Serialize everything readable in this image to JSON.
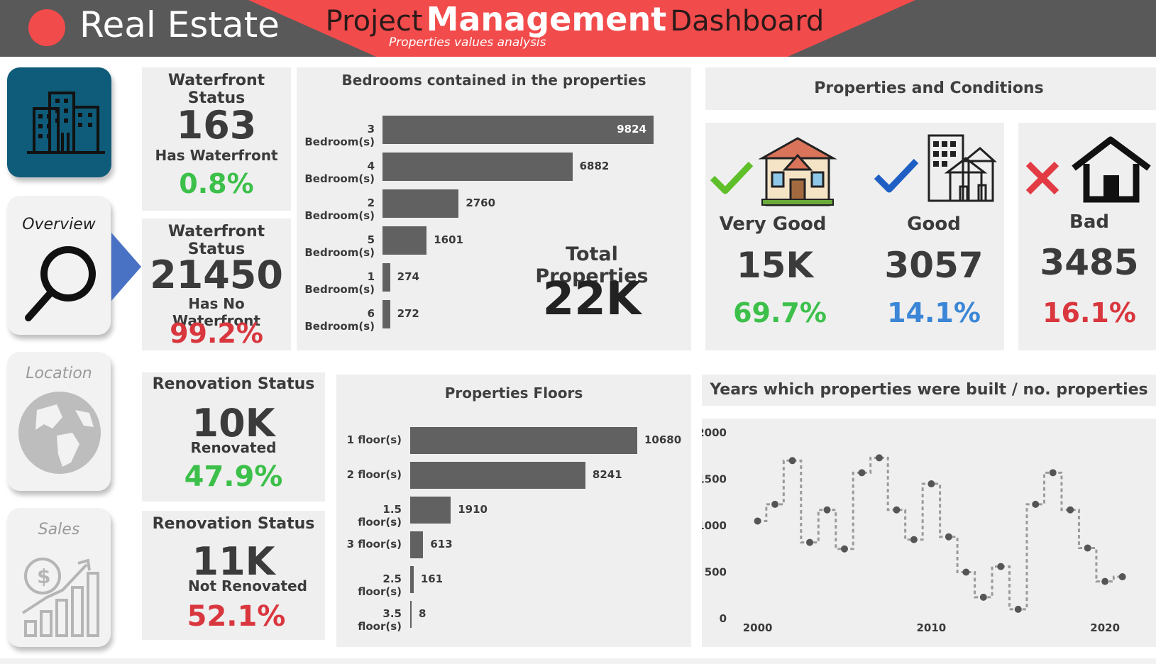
{
  "header": {
    "brand": "Real Estate",
    "title_part1": "Project",
    "title_part2": "Management",
    "title_part3": "Dashboard",
    "subtitle": "Properties values analysis",
    "colors": {
      "bar": "#595959",
      "accent": "#f24b4b"
    }
  },
  "sidebar": {
    "items": [
      {
        "label": "Overview",
        "icon": "magnifier-icon",
        "active": true
      },
      {
        "label": "Location",
        "icon": "globe-icon",
        "active": false
      },
      {
        "label": "Sales",
        "icon": "sales-growth-icon",
        "active": false
      }
    ],
    "logo_icon": "city-buildings-icon"
  },
  "waterfront": {
    "title": "Waterfront Status",
    "has": {
      "value": "163",
      "label": "Has Waterfront",
      "pct": "0.8%"
    },
    "has_no": {
      "value": "21450",
      "label": "Has No Waterfront",
      "pct": "99.2%"
    }
  },
  "renovation": {
    "title": "Renovation Status",
    "renovated": {
      "value": "10K",
      "label": "Renovated",
      "pct": "47.9%"
    },
    "not_renovated": {
      "value": "11K",
      "label": "Not Renovated",
      "pct": "52.1%"
    }
  },
  "total": {
    "label": "Total Properties",
    "value": "22K"
  },
  "conditions": {
    "title": "Properties and Conditions",
    "items": [
      {
        "label": "Very Good",
        "value": "15K",
        "pct": "69.7%",
        "mark_icon": "check-green-icon",
        "icon": "house-colored-icon",
        "color": "#3cc04a"
      },
      {
        "label": "Good",
        "value": "3057",
        "pct": "14.1%",
        "mark_icon": "check-blue-icon",
        "icon": "houses-building-icon",
        "color": "#3b86d6"
      },
      {
        "label": "Bad",
        "value": "3485",
        "pct": "16.1%",
        "mark_icon": "cross-red-icon",
        "icon": "house-outline-icon",
        "color": "#d9363e"
      }
    ]
  },
  "chart_data": [
    {
      "type": "bar",
      "orientation": "horizontal",
      "title": "Bedrooms contained in the properties",
      "categories": [
        "3 Bedroom(s)",
        "4 Bedroom(s)",
        "2 Bedroom(s)",
        "5 Bedroom(s)",
        "1 Bedroom(s)",
        "6 Bedroom(s)"
      ],
      "values": [
        9824,
        6882,
        2760,
        1601,
        274,
        272
      ]
    },
    {
      "type": "bar",
      "orientation": "horizontal",
      "title": "Properties Floors",
      "categories": [
        "1 floor(s)",
        "2 floor(s)",
        "1.5 floor(s)",
        "3 floor(s)",
        "2.5 floor(s)",
        "3.5 floor(s)"
      ],
      "values": [
        10680,
        8241,
        1910,
        613,
        161,
        8
      ]
    },
    {
      "type": "line",
      "style": "step-dotted",
      "title": "Years which properties were built / no. properties",
      "x": [
        2000,
        2001,
        2002,
        2003,
        2004,
        2005,
        2006,
        2007,
        2008,
        2009,
        2010,
        2011,
        2012,
        2013,
        2014,
        2015,
        2016,
        2017,
        2018,
        2019,
        2020,
        2021
      ],
      "y": [
        1050,
        1230,
        1700,
        820,
        1170,
        750,
        1570,
        1730,
        1170,
        850,
        1450,
        880,
        500,
        230,
        560,
        100,
        1230,
        1570,
        1170,
        760,
        400,
        450
      ],
      "xticks": [
        2000,
        2010,
        2020
      ],
      "yticks": [
        0,
        500,
        1000,
        1500,
        2000
      ],
      "ylim": [
        0,
        2000
      ],
      "xlim": [
        1998.3,
        2022.2
      ]
    }
  ]
}
